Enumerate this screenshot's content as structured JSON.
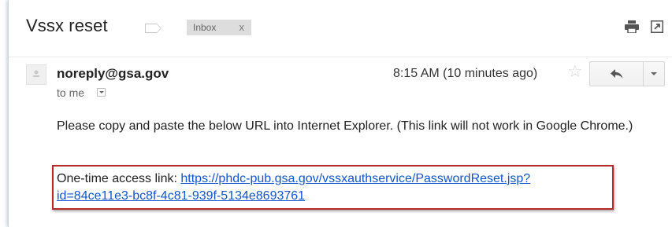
{
  "subject": "Vssx reset",
  "labels": {
    "inbox": "Inbox",
    "inbox_remove": "x"
  },
  "toolbar": {
    "print_icon": "print-icon",
    "popout_icon": "new-window-icon"
  },
  "message": {
    "sender": "noreply@gsa.gov",
    "to": "to me",
    "time": "8:15 AM (10 minutes ago)",
    "star": "☆",
    "body": "Please copy and paste the below URL into Internet Explorer. (This link will not work in Google Chrome.)",
    "link_prefix": "One-time access link: ",
    "link_text_line1": "https://phdc-pub.gsa.gov/vssxauthservice/PasswordReset.jsp?",
    "link_text_line2": "id=84ce11e3-bc8f-4c81-939f-5134e8693761"
  },
  "colors": {
    "link": "#1155cc",
    "highlight_border": "#b62a2a",
    "chip_bg": "#dddddd"
  }
}
